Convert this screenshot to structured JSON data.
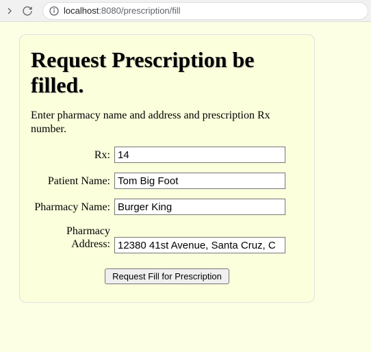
{
  "browser": {
    "url_host": "localhost",
    "url_rest": ":8080/prescription/fill"
  },
  "page": {
    "heading": "Request Prescription be filled.",
    "subtitle": "Enter pharmacy name and address and prescription Rx number.",
    "labels": {
      "rx": "Rx:",
      "patient_name": "Patient Name:",
      "pharmacy_name": "Pharmacy Name:",
      "pharmacy_address": "Pharmacy Address:"
    },
    "values": {
      "rx": "14",
      "patient_name": "Tom Big Foot",
      "pharmacy_name": "Burger King",
      "pharmacy_address": "12380 41st Avenue, Santa Cruz, C"
    },
    "submit_label": "Request Fill for Prescription"
  }
}
